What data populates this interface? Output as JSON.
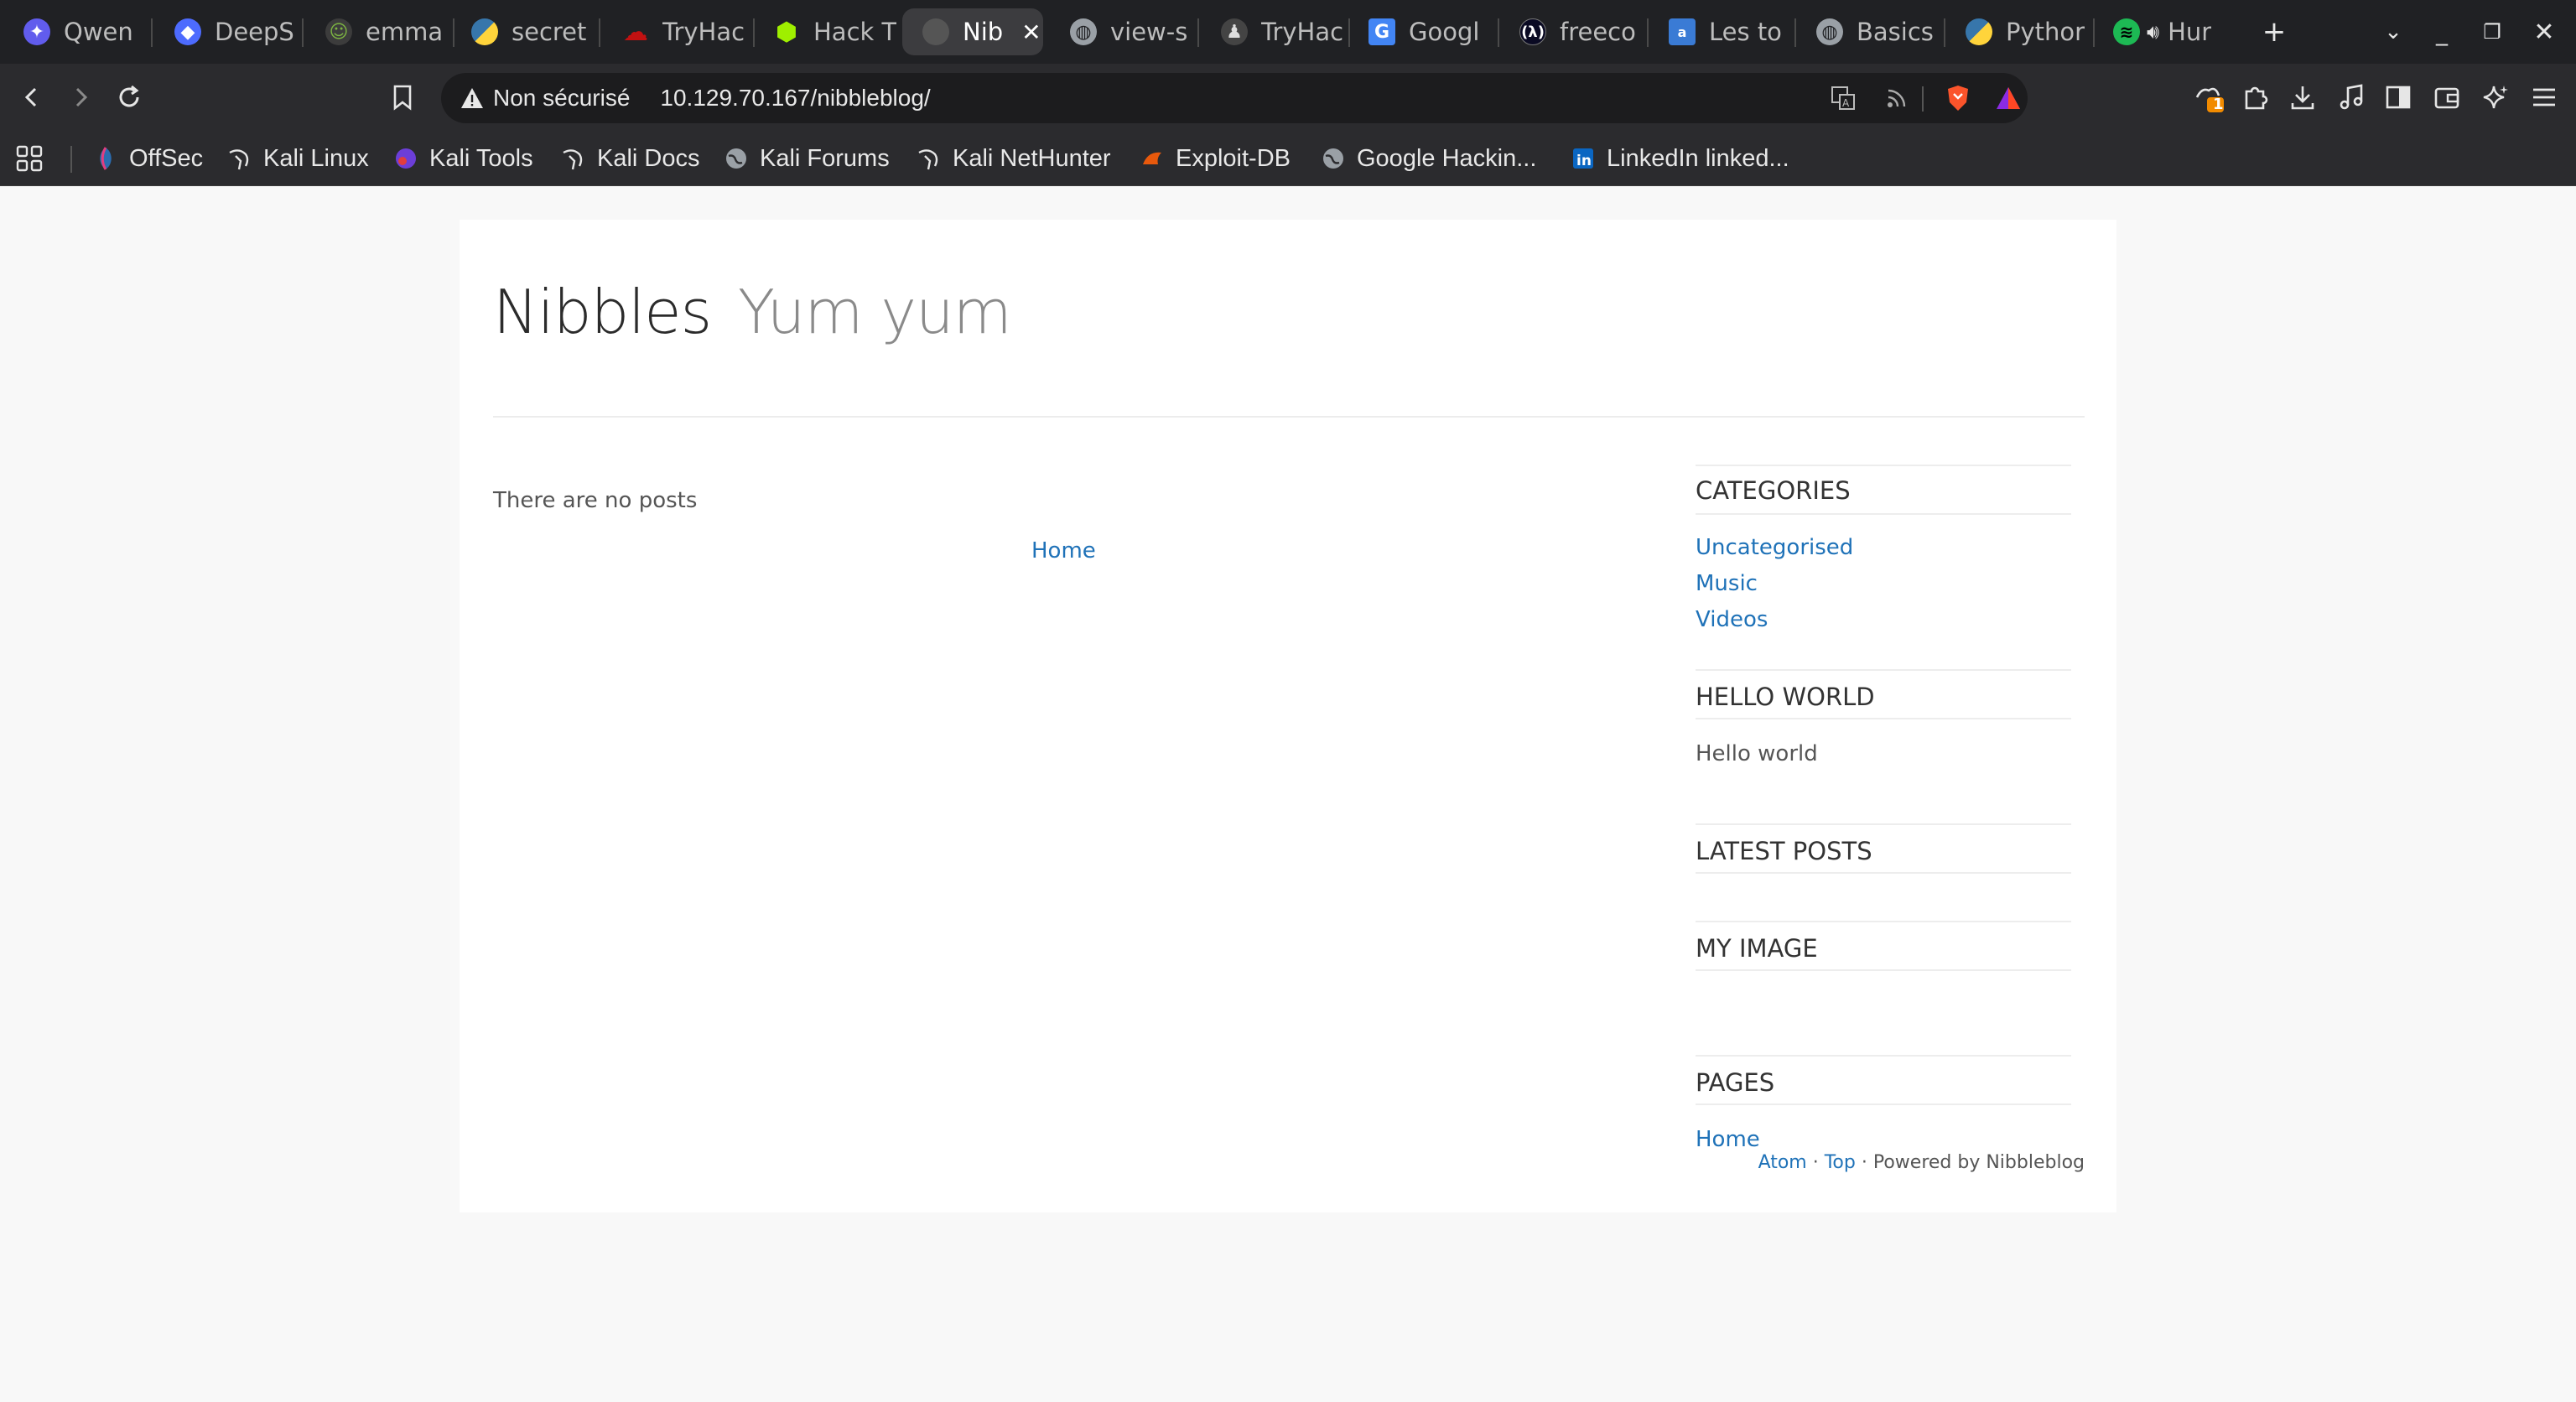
{
  "browser": {
    "tabs": [
      {
        "label": "Qwen",
        "icon": "qwen-icon",
        "color": "#615ced"
      },
      {
        "label": "DeepS",
        "icon": "deepseek-icon",
        "color": "#4d6bfe"
      },
      {
        "label": "emma",
        "icon": "emma-icon",
        "color": "#7cb342"
      },
      {
        "label": "secret",
        "icon": "python-icon",
        "color": "#3776ab"
      },
      {
        "label": "TryHac",
        "icon": "tryhackme-icon",
        "color": "#c11111"
      },
      {
        "label": "Hack T",
        "icon": "hackthebox-icon",
        "color": "#9fef00"
      },
      {
        "label": "Nib",
        "icon": "nibbles-icon",
        "color": "#6b6b6b",
        "active": true
      },
      {
        "label": "view-s",
        "icon": "globe-icon",
        "color": "#9aa0a6"
      },
      {
        "label": "TryHac",
        "icon": "tryhackme-icon",
        "color": "#c8c8c8"
      },
      {
        "label": "Googl",
        "icon": "google-translate-icon",
        "color": "#4285f4"
      },
      {
        "label": "freeco",
        "icon": "freecodecamp-icon",
        "color": "#0a0a23"
      },
      {
        "label": "Les to",
        "icon": "lestop-icon",
        "color": "#3a7bd5"
      },
      {
        "label": "Basics",
        "icon": "globe-icon",
        "color": "#9aa0a6"
      },
      {
        "label": "Pythor",
        "icon": "python-icon",
        "color": "#3776ab"
      },
      {
        "label": "Hur",
        "icon": "spotify-icon",
        "color": "#1db954"
      }
    ],
    "new_tab": "+",
    "address": {
      "security_label": "Non sécurisé",
      "url": "10.129.70.167/nibbleblog/"
    },
    "notification_badge": "1",
    "bookmarks": [
      {
        "label": "OffSec",
        "icon": "offsec-icon"
      },
      {
        "label": "Kali Linux",
        "icon": "kali-icon"
      },
      {
        "label": "Kali Tools",
        "icon": "kali-tools-icon"
      },
      {
        "label": "Kali Docs",
        "icon": "kali-icon"
      },
      {
        "label": "Kali Forums",
        "icon": "globe-icon"
      },
      {
        "label": "Kali NetHunter",
        "icon": "kali-icon"
      },
      {
        "label": "Exploit-DB",
        "icon": "exploitdb-icon"
      },
      {
        "label": "Google Hackin...",
        "icon": "globe-icon"
      },
      {
        "label": "LinkedIn linked...",
        "icon": "linkedin-icon"
      }
    ]
  },
  "site": {
    "name": "Nibbles",
    "slogan": "Yum yum",
    "no_posts": "There are no posts",
    "home_link": "Home",
    "sidebar": {
      "categories_title": "CATEGORIES",
      "categories": [
        "Uncategorised",
        "Music",
        "Videos"
      ],
      "hello_title": "HELLO WORLD",
      "hello_text": "Hello world",
      "latest_title": "LATEST POSTS",
      "image_title": "MY IMAGE",
      "pages_title": "PAGES",
      "pages": [
        "Home"
      ]
    },
    "footer": {
      "atom": "Atom",
      "sep1": " · ",
      "top": "Top",
      "sep2": " · ",
      "powered": "Powered by Nibbleblog"
    }
  },
  "colors": {
    "link": "#1f72b8",
    "chrome_bg": "#202124",
    "page_bg": "#f8f8f8"
  }
}
